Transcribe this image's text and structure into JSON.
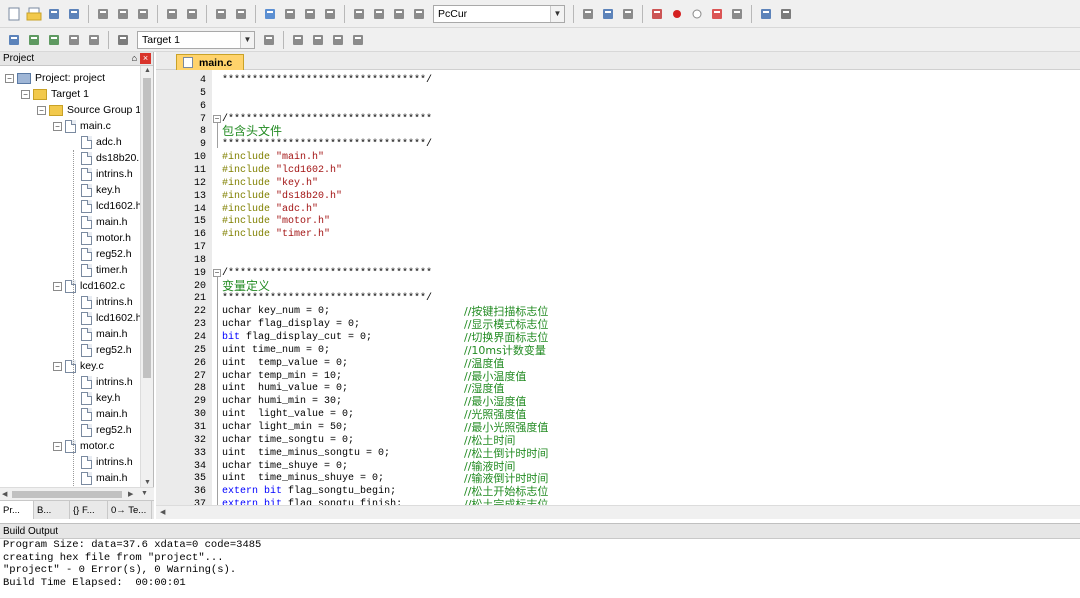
{
  "toolbar1": {
    "icons": [
      "new-file-icon",
      "open-file-icon",
      "save-icon",
      "save-all-icon",
      "cut-icon",
      "copy-icon",
      "paste-icon",
      "undo-icon",
      "redo-icon",
      "back-icon",
      "forward-icon",
      "bookmark-icon",
      "prev-bookmark-icon",
      "next-bookmark-icon",
      "clear-bookmarks-icon",
      "indent-icon",
      "unindent-icon",
      "comment-icon",
      "uncomment-icon",
      "find-in-files-icon",
      "find-icon",
      "incremental-find-icon",
      "debug-icon",
      "breakpoint-icon",
      "disable-breakpoint-icon",
      "kill-breakpoints-icon",
      "clear-breakpoints-icon",
      "windows-icon",
      "configure-icon"
    ],
    "find_combo": "PcCur"
  },
  "toolbar2": {
    "icons": [
      "translate-icon",
      "build-icon",
      "rebuild-icon",
      "batch-build-icon",
      "stop-build-icon",
      "download-icon",
      "options-icon",
      "manage-components-icon",
      "select-device-icon",
      "packs-icon",
      "pack-installer-icon"
    ],
    "target_combo": "Target 1"
  },
  "project": {
    "title": "Project",
    "pin": "⌂",
    "close": "×",
    "tree": [
      {
        "label": "Project: project",
        "level": 0,
        "kind": "project",
        "toggle": "−"
      },
      {
        "label": "Target 1",
        "level": 1,
        "kind": "target",
        "toggle": "−"
      },
      {
        "label": "Source Group 1",
        "level": 2,
        "kind": "folder",
        "toggle": "−"
      },
      {
        "label": "main.c",
        "level": 3,
        "kind": "file",
        "toggle": "−"
      },
      {
        "label": "adc.h",
        "level": 4,
        "kind": "file",
        "toggle": ""
      },
      {
        "label": "ds18b20.",
        "level": 4,
        "kind": "file",
        "toggle": ""
      },
      {
        "label": "intrins.h",
        "level": 4,
        "kind": "file",
        "toggle": ""
      },
      {
        "label": "key.h",
        "level": 4,
        "kind": "file",
        "toggle": ""
      },
      {
        "label": "lcd1602.h",
        "level": 4,
        "kind": "file",
        "toggle": ""
      },
      {
        "label": "main.h",
        "level": 4,
        "kind": "file",
        "toggle": ""
      },
      {
        "label": "motor.h",
        "level": 4,
        "kind": "file",
        "toggle": ""
      },
      {
        "label": "reg52.h",
        "level": 4,
        "kind": "file",
        "toggle": ""
      },
      {
        "label": "timer.h",
        "level": 4,
        "kind": "file",
        "toggle": ""
      },
      {
        "label": "lcd1602.c",
        "level": 3,
        "kind": "file",
        "toggle": "−"
      },
      {
        "label": "intrins.h",
        "level": 4,
        "kind": "file",
        "toggle": ""
      },
      {
        "label": "lcd1602.h",
        "level": 4,
        "kind": "file",
        "toggle": ""
      },
      {
        "label": "main.h",
        "level": 4,
        "kind": "file",
        "toggle": ""
      },
      {
        "label": "reg52.h",
        "level": 4,
        "kind": "file",
        "toggle": ""
      },
      {
        "label": "key.c",
        "level": 3,
        "kind": "file",
        "toggle": "−"
      },
      {
        "label": "intrins.h",
        "level": 4,
        "kind": "file",
        "toggle": ""
      },
      {
        "label": "key.h",
        "level": 4,
        "kind": "file",
        "toggle": ""
      },
      {
        "label": "main.h",
        "level": 4,
        "kind": "file",
        "toggle": ""
      },
      {
        "label": "reg52.h",
        "level": 4,
        "kind": "file",
        "toggle": ""
      },
      {
        "label": "motor.c",
        "level": 3,
        "kind": "file",
        "toggle": "−"
      },
      {
        "label": "intrins.h",
        "level": 4,
        "kind": "file",
        "toggle": ""
      },
      {
        "label": "main.h",
        "level": 4,
        "kind": "file",
        "toggle": ""
      }
    ],
    "tabs": [
      "Pr...",
      "B...",
      "{} F...",
      "0→ Te..."
    ]
  },
  "editor": {
    "tab": "main.c",
    "lines": [
      {
        "n": "4",
        "fold": "",
        "parts": [
          {
            "t": "**********************************/",
            "c": "cmt"
          }
        ]
      },
      {
        "n": "5",
        "fold": "",
        "parts": []
      },
      {
        "n": "6",
        "fold": "",
        "parts": []
      },
      {
        "n": "7",
        "fold": "−",
        "parts": [
          {
            "t": "/**********************************",
            "c": "cmt"
          }
        ]
      },
      {
        "n": "8",
        "fold": "",
        "zh": true,
        "parts": [
          {
            "t": "包含头文件",
            "c": "cmt"
          }
        ]
      },
      {
        "n": "9",
        "fold": "",
        "parts": [
          {
            "t": "**********************************/",
            "c": "cmt"
          }
        ]
      },
      {
        "n": "10",
        "fold": "",
        "parts": [
          {
            "t": "#include ",
            "c": "pp"
          },
          {
            "t": "\"main.h\"",
            "c": "str"
          }
        ]
      },
      {
        "n": "11",
        "fold": "",
        "parts": [
          {
            "t": "#include ",
            "c": "pp"
          },
          {
            "t": "\"lcd1602.h\"",
            "c": "str"
          }
        ]
      },
      {
        "n": "12",
        "fold": "",
        "parts": [
          {
            "t": "#include ",
            "c": "pp"
          },
          {
            "t": "\"key.h\"",
            "c": "str"
          }
        ]
      },
      {
        "n": "13",
        "fold": "",
        "parts": [
          {
            "t": "#include ",
            "c": "pp"
          },
          {
            "t": "\"ds18b20.h\"",
            "c": "str"
          }
        ]
      },
      {
        "n": "14",
        "fold": "",
        "parts": [
          {
            "t": "#include ",
            "c": "pp"
          },
          {
            "t": "\"adc.h\"",
            "c": "str"
          }
        ]
      },
      {
        "n": "15",
        "fold": "",
        "parts": [
          {
            "t": "#include ",
            "c": "pp"
          },
          {
            "t": "\"motor.h\"",
            "c": "str"
          }
        ]
      },
      {
        "n": "16",
        "fold": "",
        "parts": [
          {
            "t": "#include ",
            "c": "pp"
          },
          {
            "t": "\"timer.h\"",
            "c": "str"
          }
        ]
      },
      {
        "n": "17",
        "fold": "",
        "parts": []
      },
      {
        "n": "18",
        "fold": "",
        "parts": []
      },
      {
        "n": "19",
        "fold": "−",
        "parts": [
          {
            "t": "/**********************************",
            "c": "cmt"
          }
        ]
      },
      {
        "n": "20",
        "fold": "",
        "zh": true,
        "parts": [
          {
            "t": "变量定义",
            "c": "cmt"
          }
        ]
      },
      {
        "n": "21",
        "fold": "",
        "parts": [
          {
            "t": "**********************************/",
            "c": "cmt"
          }
        ]
      },
      {
        "n": "22",
        "fold": "",
        "parts": [
          {
            "t": "uchar key_num = 0;",
            "c": ""
          }
        ],
        "comment": "//按键扫描标志位"
      },
      {
        "n": "23",
        "fold": "",
        "parts": [
          {
            "t": "uchar flag_display = 0;",
            "c": ""
          }
        ],
        "comment": "//显示模式标志位"
      },
      {
        "n": "24",
        "fold": "",
        "parts": [
          {
            "t": "bit",
            "c": "kw"
          },
          {
            "t": " flag_display_cut = 0;",
            "c": ""
          }
        ],
        "comment": "//切换界面标志位"
      },
      {
        "n": "25",
        "fold": "",
        "parts": [
          {
            "t": "uint time_num = 0;",
            "c": ""
          }
        ],
        "comment": "//10ms计数变量"
      },
      {
        "n": "26",
        "fold": "",
        "parts": [
          {
            "t": "uint  temp_value = 0;",
            "c": ""
          }
        ],
        "comment": "//温度值"
      },
      {
        "n": "27",
        "fold": "",
        "parts": [
          {
            "t": "uchar temp_min = 10;",
            "c": ""
          }
        ],
        "comment": "//最小温度值"
      },
      {
        "n": "28",
        "fold": "",
        "parts": [
          {
            "t": "uint  humi_value = 0;",
            "c": ""
          }
        ],
        "comment": "//湿度值"
      },
      {
        "n": "29",
        "fold": "",
        "parts": [
          {
            "t": "uchar humi_min = 30;",
            "c": ""
          }
        ],
        "comment": "//最小湿度值"
      },
      {
        "n": "30",
        "fold": "",
        "parts": [
          {
            "t": "uint  light_value = 0;",
            "c": ""
          }
        ],
        "comment": "//光照强度值"
      },
      {
        "n": "31",
        "fold": "",
        "parts": [
          {
            "t": "uchar light_min = 50;",
            "c": ""
          }
        ],
        "comment": "//最小光照强度值"
      },
      {
        "n": "32",
        "fold": "",
        "parts": [
          {
            "t": "uchar time_songtu = 0;",
            "c": ""
          }
        ],
        "comment": "//松土时间"
      },
      {
        "n": "33",
        "fold": "",
        "parts": [
          {
            "t": "uint  time_minus_songtu = 0;",
            "c": ""
          }
        ],
        "comment": "//松土倒计时时间"
      },
      {
        "n": "34",
        "fold": "",
        "parts": [
          {
            "t": "uchar time_shuye = 0;",
            "c": ""
          }
        ],
        "comment": "//输液时间"
      },
      {
        "n": "35",
        "fold": "",
        "parts": [
          {
            "t": "uint  time_minus_shuye = 0;",
            "c": ""
          }
        ],
        "comment": "//输液倒计时时间"
      },
      {
        "n": "36",
        "fold": "",
        "parts": [
          {
            "t": "extern",
            "c": "kw"
          },
          {
            "t": " ",
            "c": ""
          },
          {
            "t": "bit",
            "c": "kw"
          },
          {
            "t": " flag_songtu_begin;",
            "c": ""
          }
        ],
        "comment": "//松土开始标志位"
      },
      {
        "n": "37",
        "fold": "",
        "parts": [
          {
            "t": "extern",
            "c": "kw"
          },
          {
            "t": " ",
            "c": ""
          },
          {
            "t": "bit",
            "c": "kw"
          },
          {
            "t": " flag_songtu_finish;",
            "c": ""
          }
        ],
        "comment": "//松土完成标志位"
      }
    ]
  },
  "build_output": {
    "title": "Build Output",
    "lines": [
      "Program Size: data=37.6 xdata=0 code=3485",
      "creating hex file from \"project\"...",
      "\"project\" - 0 Error(s), 0 Warning(s).",
      "Build Time Elapsed:  00:00:01"
    ]
  }
}
